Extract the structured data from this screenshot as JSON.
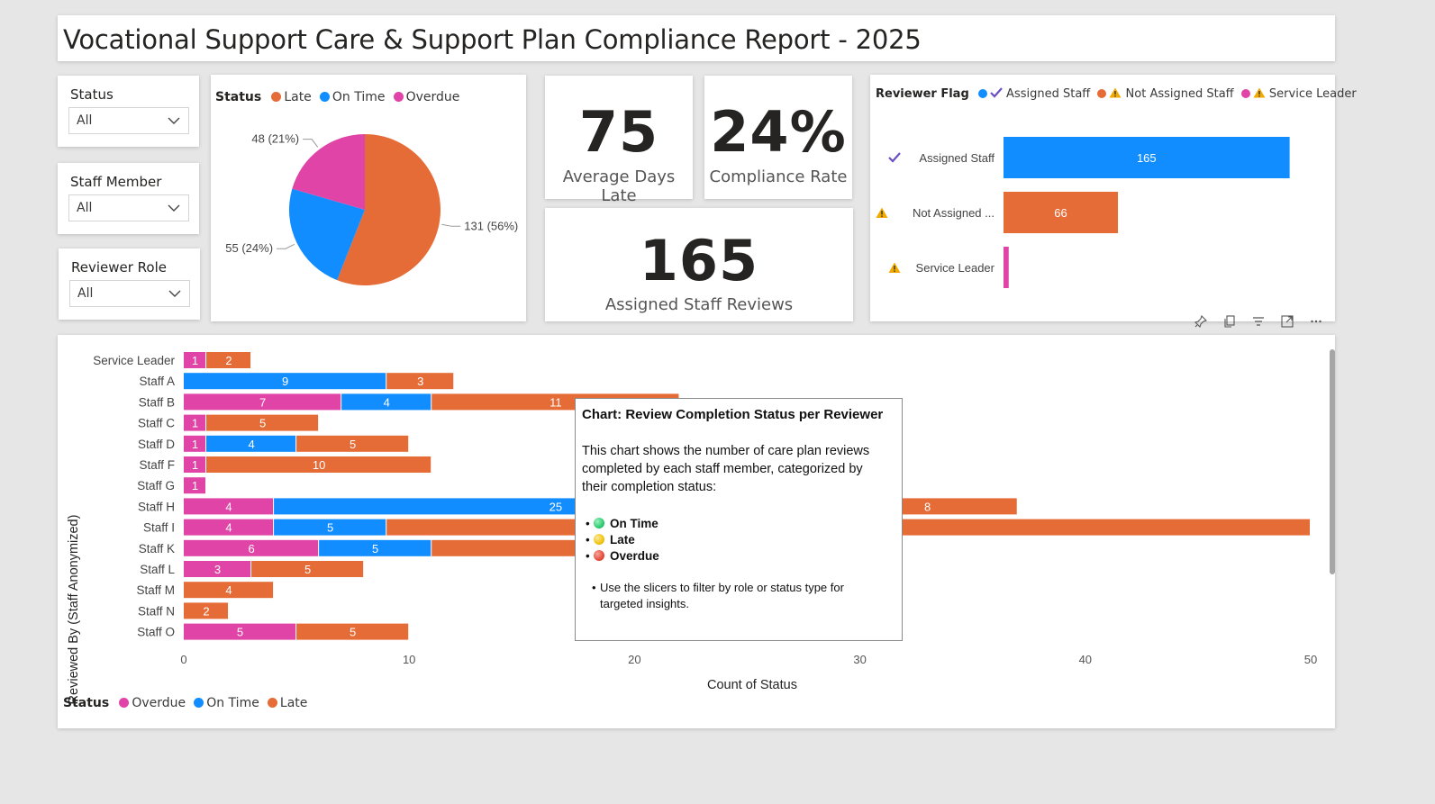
{
  "title": "Vocational Support Care & Support Plan Compliance Report - 2025",
  "colors": {
    "late": "#E66C37",
    "on_time": "#118DFF",
    "overdue": "#E044A7",
    "warning": "#F2A900",
    "check": "#6B4EC4"
  },
  "slicers": [
    {
      "label": "Status",
      "value": "All"
    },
    {
      "label": "Staff Member",
      "value": "All"
    },
    {
      "label": "Reviewer Role",
      "value": "All"
    }
  ],
  "pie": {
    "legend_title": "Status",
    "legend": [
      "Late",
      "On Time",
      "Overdue"
    ],
    "labels": {
      "late": "131 (56%)",
      "on_time": "55 (24%)",
      "overdue": "48 (21%)"
    }
  },
  "kpis": {
    "avg_days_late": {
      "value": "75",
      "label": "Average Days Late"
    },
    "compliance_rate": {
      "value": "24%",
      "label": "Compliance Rate"
    },
    "assigned_reviews": {
      "value": "165",
      "label": "Assigned Staff Reviews"
    }
  },
  "reviewer_flag": {
    "legend_title": "Reviewer Flag",
    "legend": [
      "Assigned Staff",
      "Not Assigned Staff",
      "Service Leader"
    ],
    "rows": [
      {
        "label": "Assigned Staff",
        "value_label": "165",
        "icon": "check-icon"
      },
      {
        "label": "Not Assigned ...",
        "value_label": "66",
        "icon": "warning-icon"
      },
      {
        "label": "Service Leader",
        "value_label": "",
        "icon": "warning-icon"
      }
    ]
  },
  "visual_header_icons": [
    "pin-icon",
    "copy-icon",
    "filter-icon",
    "focus-mode-icon",
    "more-options-icon"
  ],
  "chart_data": [
    {
      "type": "pie",
      "legend_title": "Status",
      "categories": [
        "Late",
        "On Time",
        "Overdue"
      ],
      "values": [
        131,
        55,
        48
      ],
      "percent_labels": [
        "56%",
        "24%",
        "21%"
      ]
    },
    {
      "type": "bar",
      "orientation": "horizontal",
      "legend_title": "Reviewer Flag",
      "categories": [
        "Assigned Staff",
        "Not Assigned Staff",
        "Service Leader"
      ],
      "values": [
        165,
        66,
        3
      ],
      "data_labels": [
        "165",
        "66",
        ""
      ],
      "xlim": [
        0,
        200
      ]
    },
    {
      "type": "bar",
      "orientation": "horizontal",
      "stacked": true,
      "xlabel": "Count of Status",
      "ylabel": "Reviewed By (Staff Anonymized)",
      "xlim": [
        0,
        50
      ],
      "xticks": [
        0,
        10,
        20,
        30,
        40,
        50
      ],
      "legend_title": "Status",
      "legend": [
        "Overdue",
        "On Time",
        "Late"
      ],
      "categories": [
        "Service Leader",
        "Staff A",
        "Staff B",
        "Staff C",
        "Staff D",
        "Staff F",
        "Staff G",
        "Staff H",
        "Staff I",
        "Staff K",
        "Staff L",
        "Staff M",
        "Staff N",
        "Staff O"
      ],
      "series": [
        {
          "name": "Overdue",
          "values": [
            1,
            0,
            7,
            1,
            1,
            1,
            1,
            4,
            4,
            6,
            3,
            0,
            0,
            5
          ]
        },
        {
          "name": "On Time",
          "values": [
            0,
            9,
            4,
            0,
            4,
            0,
            0,
            25,
            5,
            5,
            0,
            0,
            0,
            0
          ]
        },
        {
          "name": "Late",
          "values": [
            2,
            3,
            11,
            5,
            5,
            10,
            0,
            8,
            41,
            13,
            5,
            4,
            2,
            5
          ]
        }
      ],
      "data_labels_shown": [
        [
          "1",
          "",
          "2"
        ],
        [
          "",
          "9",
          "3"
        ],
        [
          "7",
          "4",
          "11"
        ],
        [
          "1",
          "",
          "5"
        ],
        [
          "1",
          "4",
          "5"
        ],
        [
          "1",
          "",
          "10"
        ],
        [
          "1",
          "",
          ""
        ],
        [
          "4",
          "25",
          "8"
        ],
        [
          "4",
          "5",
          ""
        ],
        [
          "6",
          "5",
          ""
        ],
        [
          "3",
          "",
          "5"
        ],
        [
          "",
          "",
          "4"
        ],
        [
          "",
          "",
          "2"
        ],
        [
          "5",
          "",
          "5"
        ]
      ]
    }
  ],
  "tooltip": {
    "title": "Chart: Review Completion Status per Reviewer",
    "body": "This chart shows the number of care plan reviews completed by each staff member, categorized by their completion status:",
    "items": [
      {
        "label": "On Time",
        "color": "#2ecc71"
      },
      {
        "label": "Late",
        "color": "#f1c40f"
      },
      {
        "label": "Overdue",
        "color": "#e74c3c"
      }
    ],
    "note": "Use the slicers to filter by role or status type for targeted insights."
  }
}
